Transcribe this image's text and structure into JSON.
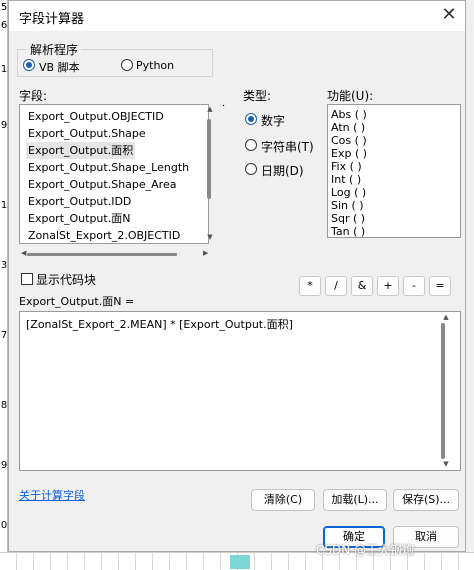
{
  "background": {
    "left_chars": [
      "5",
      "6",
      "1",
      "9",
      "1",
      "3",
      "7",
      "8",
      "9",
      "0"
    ]
  },
  "dialog": {
    "title": "字段计算器",
    "close_glyph": "✕"
  },
  "parser": {
    "legend": "解析程序",
    "options": [
      {
        "label": "VB 脚本",
        "selected": true
      },
      {
        "label": "Python",
        "selected": false
      }
    ]
  },
  "fields": {
    "label": "字段:",
    "items": [
      "Export_Output.OBJECTID",
      "Export_Output.Shape",
      "Export_Output.面积",
      "Export_Output.Shape_Length",
      "Export_Output.Shape_Area",
      "Export_Output.IDD",
      "Export_Output.面N",
      "ZonalSt_Export_2.OBJECTID"
    ],
    "selected_index": 2
  },
  "type": {
    "label": "类型:",
    "options": [
      {
        "label": "数字",
        "selected": true
      },
      {
        "label": "字符串(T)",
        "selected": false
      },
      {
        "label": "日期(D)",
        "selected": false
      }
    ]
  },
  "functions": {
    "label": "功能(U):",
    "items": [
      "Abs ( )",
      "Atn ( )",
      "Cos ( )",
      "Exp ( )",
      "Fix ( )",
      "Int ( )",
      "Log ( )",
      "Sin ( )",
      "Sqr ( )",
      "Tan ( )"
    ]
  },
  "show_codeblock": {
    "label": "显示代码块",
    "checked": false
  },
  "operators": [
    "*",
    "/",
    "&",
    "+",
    "-",
    "="
  ],
  "expression": {
    "target_label": "Export_Output.面N =",
    "value": "[ZonalSt_Export_2.MEAN] * [Export_Output.面积]"
  },
  "help_link": "关于计算字段",
  "buttons": {
    "clear": "清除(C)",
    "load": "加载(L)...",
    "save": "保存(S)...",
    "ok": "确定",
    "cancel": "取消"
  },
  "watermark": "CSDN @王大钢炮",
  "colors": {
    "accent": "#1a5fb4",
    "link": "#0b5ed7",
    "primary_border": "#0a64d6"
  }
}
